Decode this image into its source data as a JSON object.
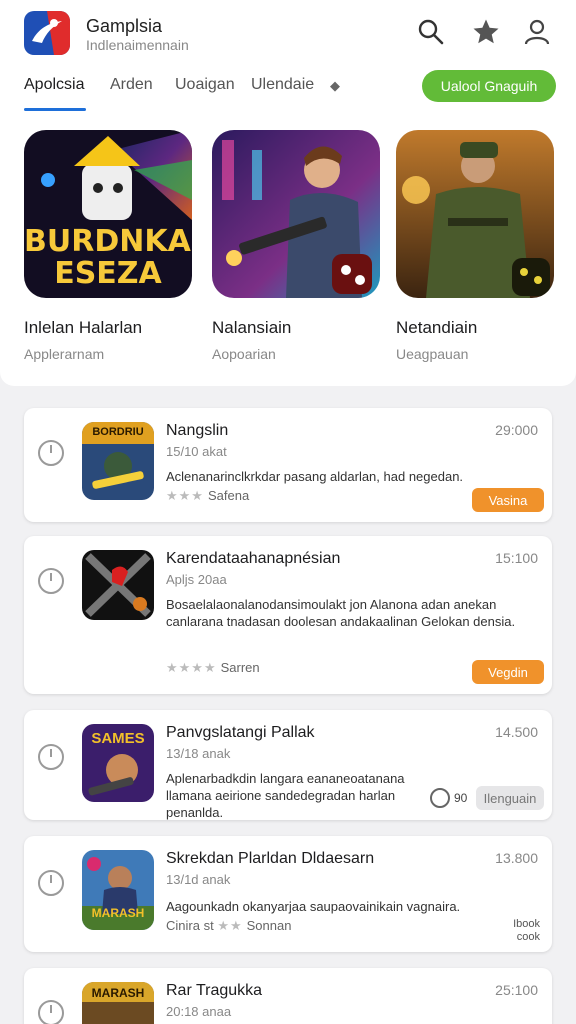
{
  "header": {
    "title": "Gamplsia",
    "subtitle": "Indlenaimennain"
  },
  "tabs": [
    {
      "label": "Apolcsia"
    },
    {
      "label": "Arden"
    },
    {
      "label": "Uoaigan"
    },
    {
      "label": "Ulendaie"
    }
  ],
  "cta_label": "Ualool Gnaguih",
  "featured": [
    {
      "name": "Inlelan Halarlan",
      "category": "Applerarnam",
      "art_text_1": "BURDNKAI",
      "art_text_2": "ESEZA"
    },
    {
      "name": "Nalansiain",
      "category": "Aopoarian"
    },
    {
      "name": "Netandiain",
      "category": "Ueagpauan"
    }
  ],
  "list": [
    {
      "title": "Nangslin",
      "date": "15/10 akat",
      "time": "29:000",
      "desc": "Aclenanarinclkrkdar pasang aldarlan, had negedan.",
      "rating_text": "Safena",
      "button": "Vasina",
      "thumb_text": "BORDRIU"
    },
    {
      "title": "Karendataahanapnésian",
      "date": "Apljs 20aa",
      "time": "15:100",
      "desc": "Bosaelalaonalanodansimoulakt jon Alanona adan anekan canlarana tnadasan doolesan andakaalinan Gelokan densia.",
      "rating_text": "Sarren",
      "button": "Vegdin"
    },
    {
      "title": "Panvgslatangi Pallak",
      "date": "13/18 anak",
      "time": "14.500",
      "desc": "Aplenarbadkdin langara eananeoatanana llamana aeirione sandedegradan harlan penanlda.",
      "extra": "90",
      "button": "Ilenguain",
      "thumb_text": "SAMES"
    },
    {
      "title": "Skrekdan Plarldan Dldaesarn",
      "date": "13/1d anak",
      "time": "13.800",
      "desc": "Aagounkadn okanyarjaa saupaovainikain vagnaira.",
      "rating_text": "Sonnan",
      "rating_prefix": "Cinira st",
      "button": "Ibook cook",
      "thumb_text": "MARASH"
    },
    {
      "title": "Rar Tragukka",
      "date": "20:18 anaa",
      "time": "25:100",
      "thumb_text": "MARASH"
    }
  ],
  "colors": {
    "accent_blue": "#1e6fd9",
    "cta_green": "#62bb38",
    "button_orange": "#f0922b"
  },
  "icons": [
    "app-logo-icon",
    "search-icon",
    "star-icon",
    "user-icon",
    "dot-icon",
    "radio-icon"
  ]
}
